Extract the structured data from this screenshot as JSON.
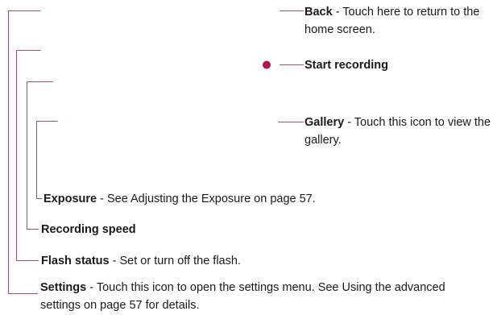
{
  "theme": {
    "line_color": "#a05270",
    "dot_color": "#b3134f"
  },
  "callouts": {
    "back": {
      "term": "Back",
      "desc": " - Touch here to return to the home screen."
    },
    "start_recording": {
      "term": "Start recording"
    },
    "gallery": {
      "term": "Gallery",
      "desc": " - Touch this icon to view the gallery."
    },
    "exposure": {
      "term": "Exposure",
      "desc": " - See Adjusting the Exposure on page 57."
    },
    "recording_speed": {
      "term": "Recording speed"
    },
    "flash_status": {
      "term": "Flash status",
      "desc": " - Set or turn off the flash."
    },
    "settings": {
      "term": "Settings",
      "desc": " - Touch this icon to open the settings menu. See Using the advanced settings on page 57 for details."
    }
  }
}
